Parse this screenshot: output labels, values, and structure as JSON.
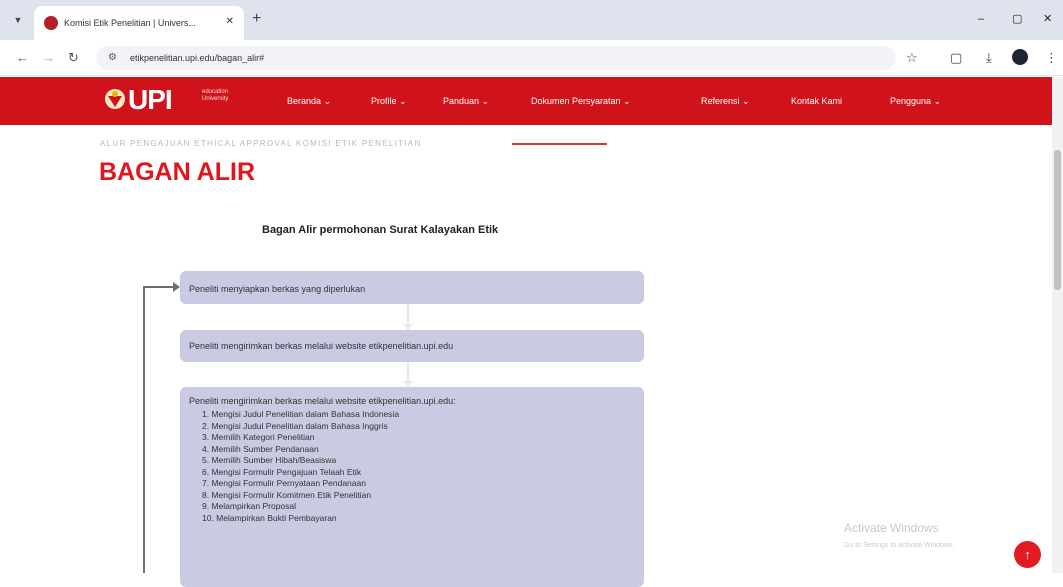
{
  "browser": {
    "tab_title": "Komisi Etik Penelitian | Univers...",
    "tab_close": "✕",
    "new_tab": "+",
    "url": "etikpenelitian.upi.edu/bagan_alir#",
    "window_controls": {
      "minimize": "–",
      "maximize": "▢",
      "close": "✕"
    },
    "nav": {
      "back": "←",
      "forward": "→",
      "reload": "↻"
    }
  },
  "site": {
    "logo_text": "UPI",
    "logo_sub": "education University",
    "nav_items": [
      "Beranda ⌄",
      "Profile ⌄",
      "Panduan ⌄",
      "Dokumen Persyaratan ⌄",
      "Referensi ⌄",
      "Kontak Kami",
      "Pengguna ⌄"
    ],
    "brand_color": "#d0131b"
  },
  "page": {
    "breadcrumb": "ALUR PENGAJUAN ETHICAL APPROVAL KOMISI ETIK PENELITIAN",
    "title": "BAGAN ALIR",
    "flow_heading": "Bagan Alir permohonan Surat Kalayakan Etik"
  },
  "flow": {
    "step1": "Peneliti menyiapkan berkas yang diperlukan",
    "step2": "Peneliti mengirimkan berkas melalui website etikpenelitian.upi.edu",
    "step3_title": "Peneliti mengirimkan berkas melalui website etikpenelitian.upi.edu:",
    "step3_items": [
      "1. Mengisi Judul Penelitian dalam Bahasa Indonesia",
      "2. Mengisi Judul Penelitian dalam Bahasa Inggris",
      "3. Memilih Kategori Penelitian",
      "4. Memilih Sumber Pendanaan",
      "5. Memilih Sumber Hibah/Beasiswa",
      "6. Mengisi Formulir Pengajuan Telaah Etik",
      "7. Mengisi Formulir Pernyataan Pendanaan",
      "8. Mengisi Formulir Komitmen Etik Penelitian",
      "9. Melampirkan Proposal",
      "10. Melampirkan Bukti Pembayaran"
    ]
  },
  "overlay": {
    "watermark_title": "Activate Windows",
    "watermark_sub": "Go to Settings to activate Windows.",
    "to_top": "↑"
  }
}
